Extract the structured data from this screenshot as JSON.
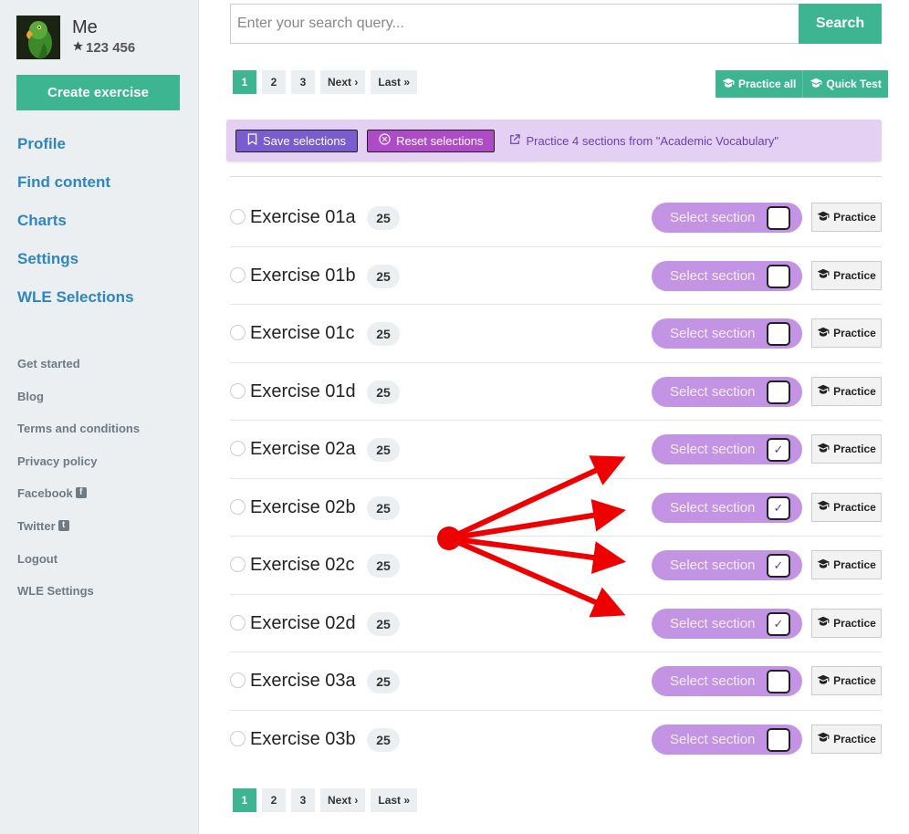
{
  "user": {
    "name": "Me",
    "score": "123 456"
  },
  "sidebar": {
    "create_label": "Create exercise",
    "nav": [
      "Profile",
      "Find content",
      "Charts",
      "Settings",
      "WLE Selections"
    ],
    "footer": [
      "Get started",
      "Blog",
      "Terms and conditions",
      "Privacy policy",
      "Facebook",
      "Twitter",
      "Logout",
      "WLE Settings"
    ]
  },
  "search": {
    "placeholder": "Enter your search query...",
    "button_label": "Search"
  },
  "pagination": {
    "pages": [
      "1",
      "2",
      "3"
    ],
    "next_label": "Next",
    "last_label": "Last",
    "current": "1"
  },
  "actions": {
    "practice_all_label": "Practice all",
    "quick_test_label": "Quick Test"
  },
  "selection_bar": {
    "save_label": "Save selections",
    "reset_label": "Reset selections",
    "practice_link": "Practice 4 sections from \"Academic Vocabulary\""
  },
  "row_labels": {
    "select": "Select section",
    "practice": "Practice"
  },
  "exercises": [
    {
      "title": "Exercise 01a",
      "count": "25",
      "selected": false
    },
    {
      "title": "Exercise 01b",
      "count": "25",
      "selected": false
    },
    {
      "title": "Exercise 01c",
      "count": "25",
      "selected": false
    },
    {
      "title": "Exercise 01d",
      "count": "25",
      "selected": false
    },
    {
      "title": "Exercise 02a",
      "count": "25",
      "selected": true
    },
    {
      "title": "Exercise 02b",
      "count": "25",
      "selected": true
    },
    {
      "title": "Exercise 02c",
      "count": "25",
      "selected": true
    },
    {
      "title": "Exercise 02d",
      "count": "25",
      "selected": true
    },
    {
      "title": "Exercise 03a",
      "count": "25",
      "selected": false
    },
    {
      "title": "Exercise 03b",
      "count": "25",
      "selected": false
    }
  ],
  "colors": {
    "accent": "#3cb590",
    "link": "#2e86c1",
    "toggle": "#c494e4",
    "selection_bar": "#e4d0f3",
    "annotation": "#ee0000"
  },
  "icons": {
    "score": "star-icon",
    "practice": "graduation-cap-icon",
    "save": "bookmark-icon",
    "reset": "close-circle-icon",
    "link": "external-link-icon"
  }
}
